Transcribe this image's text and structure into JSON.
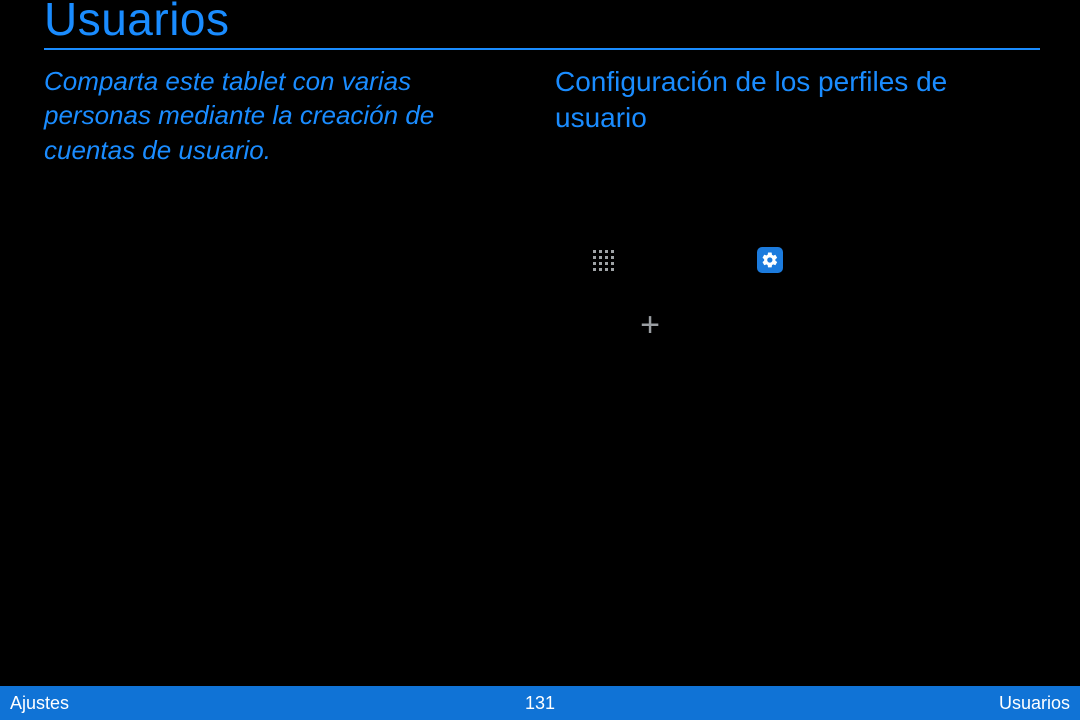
{
  "title": "Usuarios",
  "intro": "Comparta este tablet con varias personas mediante la creación de cuentas de usuario.",
  "section_heading": "Configuración de los perfiles de usuario",
  "footer": {
    "left": "Ajustes",
    "center": "131",
    "right": "Usuarios"
  },
  "icons": {
    "apps": "apps-icon",
    "settings": "settings-icon",
    "plus": "plus-icon"
  }
}
